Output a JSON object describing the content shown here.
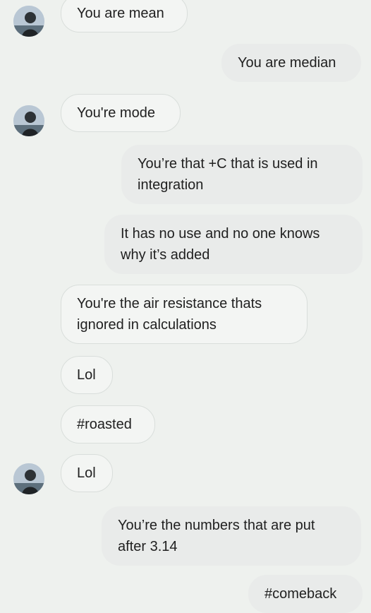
{
  "conversation": {
    "messages": [
      {
        "side": "received",
        "text": "You are mean",
        "avatar": "contact-avatar"
      },
      {
        "side": "sent",
        "text": "You are median"
      },
      {
        "side": "received",
        "text": "You're mode",
        "avatar": "contact-avatar"
      },
      {
        "side": "sent",
        "text": "You’re that +C that is used in integration"
      },
      {
        "side": "sent",
        "text": "It has no use and no one knows why it’s added"
      },
      {
        "side": "received",
        "text": "You're the air resistance thats ignored in calculations"
      },
      {
        "side": "received",
        "text": "Lol"
      },
      {
        "side": "received",
        "text": "#roasted"
      },
      {
        "side": "received",
        "text": "Lol",
        "avatar": "contact-avatar"
      },
      {
        "side": "sent",
        "text": "You’re the numbers that are put after 3.14"
      },
      {
        "side": "sent",
        "text": "#comeback"
      }
    ]
  },
  "colors": {
    "background": "#eef1ee",
    "received_bubble": "#f3f5f3",
    "received_border": "#d9dedb",
    "sent_bubble": "#e9ebea",
    "text": "#1f1f1f"
  }
}
